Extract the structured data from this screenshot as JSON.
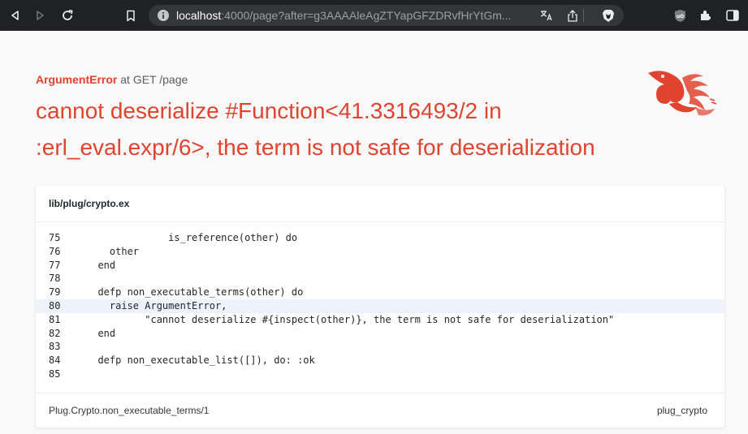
{
  "browser": {
    "url_host": "localhost",
    "url_rest": ":4000/page?after=g3AAAAleAgZTYapGFZDRvfHrYtGm..."
  },
  "error": {
    "type": "ArgumentError",
    "location": "at GET /page",
    "message": "cannot deserialize #Function<41.3316493/2 in :erl_eval.expr/6>, the term is not safe for deserialization"
  },
  "code": {
    "file": "lib/plug/crypto.ex",
    "lines": [
      {
        "num": "75",
        "text": "              is_reference(other) do"
      },
      {
        "num": "76",
        "text": "    other"
      },
      {
        "num": "77",
        "text": "  end"
      },
      {
        "num": "78",
        "text": ""
      },
      {
        "num": "79",
        "text": "  defp non_executable_terms(other) do"
      },
      {
        "num": "80",
        "text": "    raise ArgumentError,"
      },
      {
        "num": "81",
        "text": "          \"cannot deserialize #{inspect(other)}, the term is not safe for deserialization\""
      },
      {
        "num": "82",
        "text": "  end"
      },
      {
        "num": "83",
        "text": ""
      },
      {
        "num": "84",
        "text": "  defp non_executable_list([]), do: :ok"
      },
      {
        "num": "85",
        "text": ""
      }
    ],
    "highlight_line": "80",
    "function": "Plug.Crypto.non_executable_terms/1",
    "app": "plug_crypto"
  },
  "colors": {
    "accent": "#e0442f",
    "toolbar": "#202124",
    "highlight": "#eef3fb"
  },
  "icons": [
    "back-icon",
    "forward-icon",
    "reload-icon",
    "bookmark-icon",
    "info-icon",
    "translate-icon",
    "share-icon",
    "brave-shield-icon",
    "ublock-icon",
    "extensions-icon",
    "sidebar-icon",
    "phoenix-logo"
  ]
}
